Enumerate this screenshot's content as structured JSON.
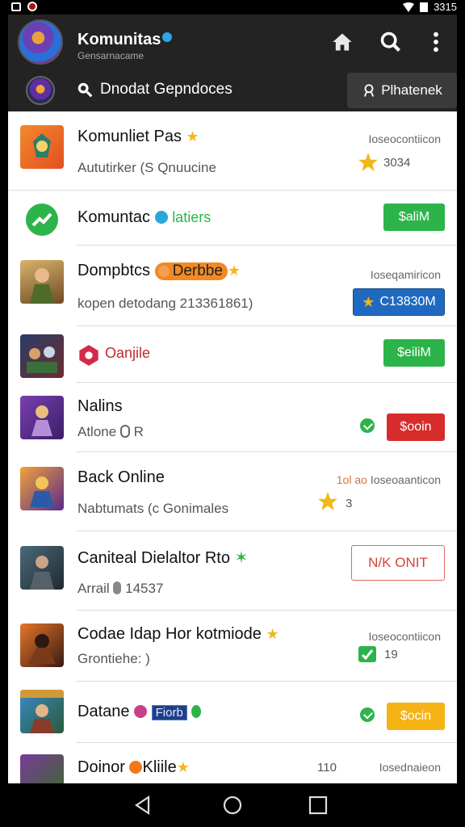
{
  "status_bar": {
    "time": "3315"
  },
  "header": {
    "title": "Komunitas",
    "subtitle": "Gensarnacame",
    "search_label": "Dnodat  Gepndoces",
    "category_button": "Plhatenek"
  },
  "rows": [
    {
      "name": "Komunliet Pas",
      "sub": "Aututirker (S Qnuucine",
      "time": "Ioseocontiicon",
      "count": "3034"
    },
    {
      "name": "Komuntac",
      "tag": "latiers",
      "button": "$aliM"
    },
    {
      "name": "Dompbtcs",
      "pill": "Derbbe",
      "sub": "kopen detodang 213361861)",
      "time": "Ioseqamiricon",
      "button": "C13830M"
    },
    {
      "name": "Oanjile",
      "button": "$eiliM"
    },
    {
      "name": "Nalins",
      "sub": "Atlone",
      "sub_extra": "R",
      "button": "$ooin"
    },
    {
      "name": "Back Online",
      "sub": "Nabtumats (c Gonimales",
      "time": "Ioseoaanticon",
      "time_prefix": "1ol  ao",
      "count": "3"
    },
    {
      "name": "Caniteal Dielaltor Rto",
      "sub": "Arrail",
      "sub_extra": "14537",
      "button": "N/K ONIT"
    },
    {
      "name": "Codae Idap Hor kotmiode",
      "sub": "Grontiehe: )",
      "time": "Ioseocontiicon",
      "count": "19"
    },
    {
      "name": "Datane",
      "tag": "Fiorb",
      "button": "$ocin"
    },
    {
      "name": "Doinor",
      "name2": "Kliile",
      "time": "Iosednaieon",
      "count": "110"
    }
  ],
  "colors": {
    "header_bg": "#232323",
    "green": "#2cb44a",
    "blue": "#1f6ac0",
    "red": "#d72c2c",
    "yellow": "#f5b315",
    "star": "#f2b81a"
  }
}
